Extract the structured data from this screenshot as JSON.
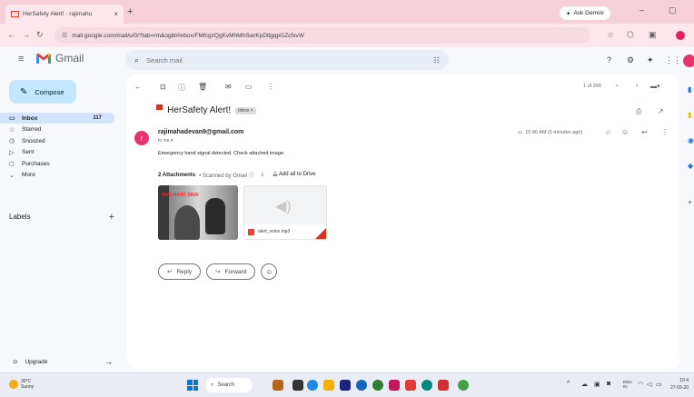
{
  "browser": {
    "tab_title": "HerSafety Alert! - rajimahu",
    "tab_close": "×",
    "new_tab": "+",
    "ask_gemini": "Ask Gemini",
    "url": "mail.google.com/mail/u/0/?tab=rm&ogbl#inbox/FMfcgzQgKvMhMhSwrKpDtlgqpGZcfxvW",
    "window_min": "–",
    "window_restore": "▢"
  },
  "gmail": {
    "brand": "Gmail",
    "search_placeholder": "Search mail",
    "compose_label": "Compose",
    "nav": [
      {
        "icon": "inbox-icon",
        "glyph": "▭",
        "label": "Inbox",
        "count": "117"
      },
      {
        "icon": "star-icon",
        "glyph": "☆",
        "label": "Starred",
        "count": ""
      },
      {
        "icon": "snooze-icon",
        "glyph": "◷",
        "label": "Snoozed",
        "count": ""
      },
      {
        "icon": "sent-icon",
        "glyph": "▷",
        "label": "Sent",
        "count": ""
      },
      {
        "icon": "purchases-icon",
        "glyph": "◻",
        "label": "Purchases",
        "count": ""
      },
      {
        "icon": "more-icon",
        "glyph": "⌄",
        "label": "More",
        "count": ""
      }
    ],
    "labels_heading": "Labels",
    "labels_add": "+",
    "upgrade_label": "Upgrade",
    "pager": "1 of 290"
  },
  "email": {
    "subject": "HerSafety Alert!",
    "inbox_chip": "Inbox ×",
    "sender_initial": "r",
    "sender": "rajimahadevan9@gmail.com",
    "to_me": "to me ▾",
    "time": "10:40 AM (0 minutes ago)",
    "body": "Emergency hand signal detected. Check attached image.",
    "attachments_count": "2 Attachments",
    "scanned": "• Scanned by Gmail ⓘ",
    "add_to_drive": "Add all to Drive",
    "image_overlay_text": "FIVE HAND SIGN",
    "audio_name": "alert_voice.mp3",
    "reply_label": "Reply",
    "forward_label": "Forward"
  },
  "taskbar": {
    "temperature": "30°C",
    "weather": "Sunny",
    "search_label": "Search",
    "lang_top": "ENG",
    "lang_bottom": "IN",
    "time": "10:4",
    "date": "27-03-20"
  },
  "colors": {
    "accent": "#c2e7ff",
    "brand_red": "#ea4335",
    "avatar": "#e8336d"
  }
}
